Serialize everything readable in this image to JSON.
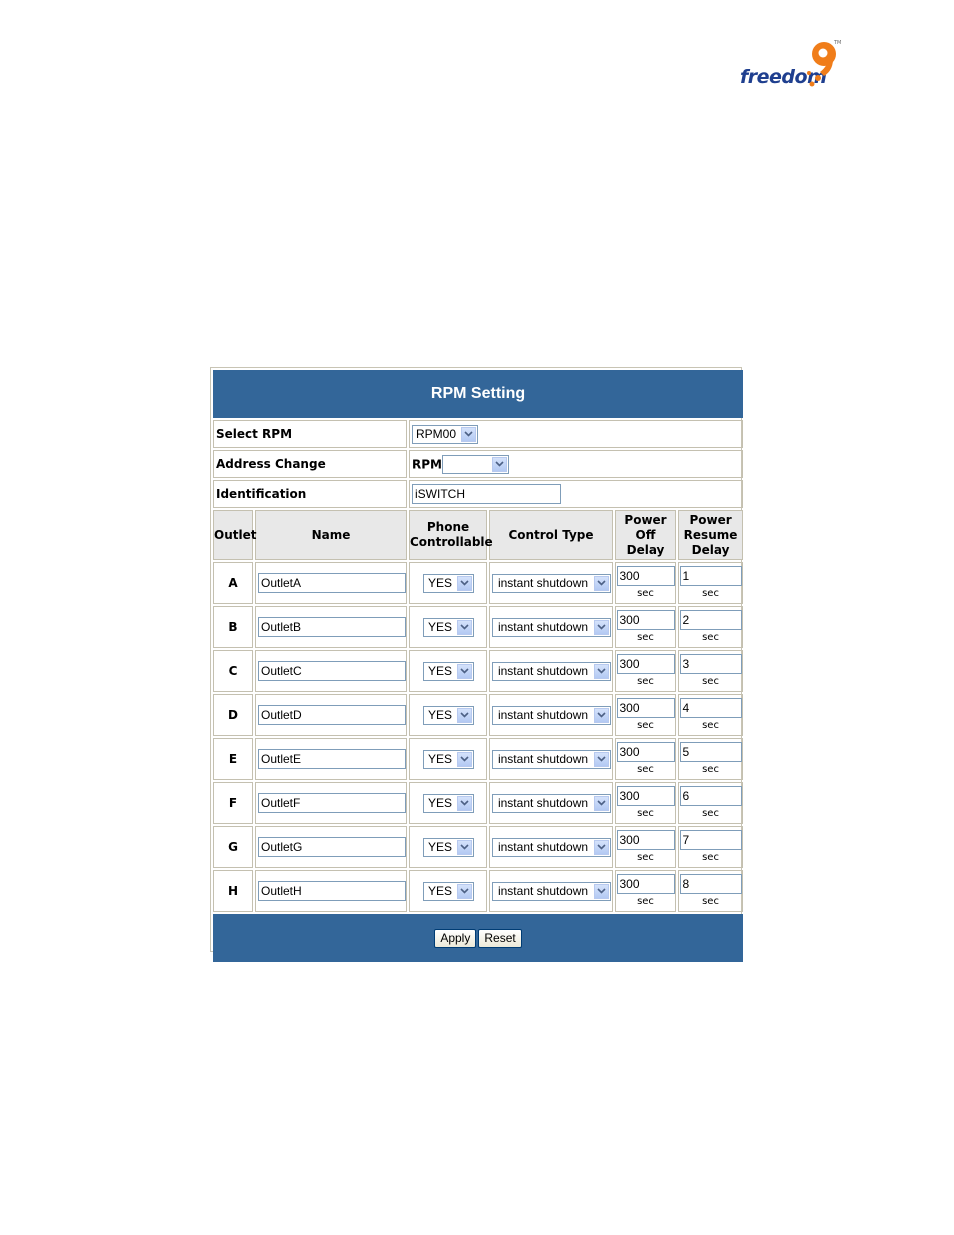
{
  "logo": {
    "text": "freedom",
    "tm": "TM",
    "brand_orange": "#f07d1a",
    "brand_blue": "#1f3f8f"
  },
  "panel": {
    "title": "RPM Setting",
    "header_color": "#336699",
    "select_rpm": {
      "label": "Select RPM",
      "value": "RPM00"
    },
    "address_change": {
      "label": "Address Change",
      "prefix": "RPM",
      "value": ""
    },
    "identification": {
      "label": "Identification",
      "value": "iSWITCH"
    },
    "columns": {
      "outlet": "Outlet",
      "name": "Name",
      "phone_1": "Phone",
      "phone_2": "Controllable",
      "control_type": "Control Type",
      "off_1": "Power",
      "off_2": "Off",
      "off_3": "Delay",
      "resume_1": "Power",
      "resume_2": "Resume",
      "resume_3": "Delay"
    },
    "unit": "sec",
    "rows": [
      {
        "outlet": "A",
        "name": "OutletA",
        "phone": "YES",
        "control": "instant shutdown",
        "off_delay": "300",
        "resume_delay": "1"
      },
      {
        "outlet": "B",
        "name": "OutletB",
        "phone": "YES",
        "control": "instant shutdown",
        "off_delay": "300",
        "resume_delay": "2"
      },
      {
        "outlet": "C",
        "name": "OutletC",
        "phone": "YES",
        "control": "instant shutdown",
        "off_delay": "300",
        "resume_delay": "3"
      },
      {
        "outlet": "D",
        "name": "OutletD",
        "phone": "YES",
        "control": "instant shutdown",
        "off_delay": "300",
        "resume_delay": "4"
      },
      {
        "outlet": "E",
        "name": "OutletE",
        "phone": "YES",
        "control": "instant shutdown",
        "off_delay": "300",
        "resume_delay": "5"
      },
      {
        "outlet": "F",
        "name": "OutletF",
        "phone": "YES",
        "control": "instant shutdown",
        "off_delay": "300",
        "resume_delay": "6"
      },
      {
        "outlet": "G",
        "name": "OutletG",
        "phone": "YES",
        "control": "instant shutdown",
        "off_delay": "300",
        "resume_delay": "7"
      },
      {
        "outlet": "H",
        "name": "OutletH",
        "phone": "YES",
        "control": "instant shutdown",
        "off_delay": "300",
        "resume_delay": "8"
      }
    ],
    "buttons": {
      "apply": "Apply",
      "reset": "Reset"
    }
  }
}
